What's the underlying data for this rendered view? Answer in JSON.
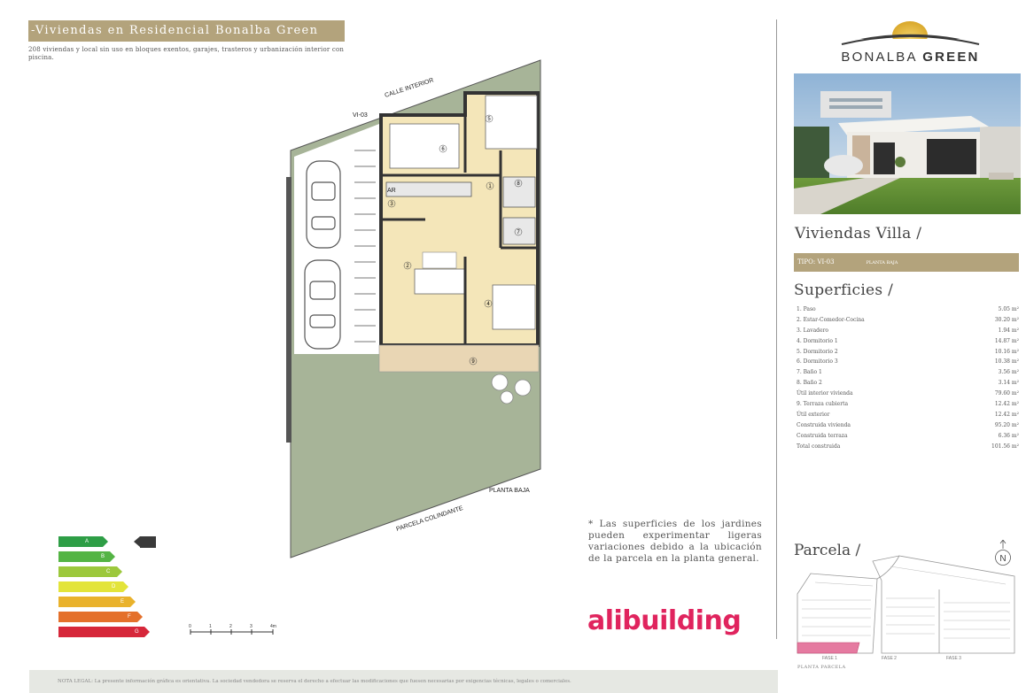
{
  "header": {
    "title": "-Viviendas en Residencial Bonalba Green",
    "subtitle": "208 viviendas y local sin uso en bloques exentos, garajes, trasteros y urbanización interior con piscina."
  },
  "plan": {
    "street_label": "CALLE INTERIOR",
    "unit_code": "VI-03",
    "floor_label": "PLANTA BAJA",
    "neighbor_label": "PARCELA COLINDANTE",
    "ar_label": "AR",
    "room_numbers": [
      "1",
      "2",
      "3",
      "4",
      "5",
      "6",
      "7",
      "8",
      "9"
    ]
  },
  "note": "* Las superficies de los jardines pueden experimentar ligeras variaciones debido a la ubicación de la parcela en la planta general.",
  "energy": {
    "classes": [
      {
        "letter": "A",
        "color": "#2e9e46"
      },
      {
        "letter": "B",
        "color": "#54b444"
      },
      {
        "letter": "C",
        "color": "#9cc83c"
      },
      {
        "letter": "D",
        "color": "#e3e43a"
      },
      {
        "letter": "E",
        "color": "#e9b22c"
      },
      {
        "letter": "F",
        "color": "#e4702b"
      },
      {
        "letter": "G",
        "color": "#d6273a"
      }
    ],
    "selected": "A"
  },
  "scale": {
    "ticks": [
      "0",
      "1",
      "2",
      "3",
      "4m"
    ]
  },
  "logo": "alibuilding",
  "legal": "NOTA LEGAL: La presente información gráfica es orientativa. La sociedad vendedora se reserva el derecho a efectuar las modificaciones que fuesen necesarias por exigencias técnicas, legales o comerciales.",
  "brand": {
    "name_light": "BONALBA",
    "name_bold": "GREEN"
  },
  "sidebar": {
    "section_villa": "Viviendas Villa /",
    "type": "TIPO: VI-03",
    "type_floor": "PLANTA BAJA",
    "section_sup": "Superficies /",
    "areas": [
      {
        "label": "1. Paso",
        "value": "5.05 m²"
      },
      {
        "label": "2. Estar-Comedor-Cocina",
        "value": "30.20 m²"
      },
      {
        "label": "3. Lavadero",
        "value": "1.94 m²"
      },
      {
        "label": "4. Dormitorio 1",
        "value": "14.87 m²"
      },
      {
        "label": "5. Dormitorio 2",
        "value": "10.16 m²"
      },
      {
        "label": "6. Dormitorio 3",
        "value": "10.38 m²"
      },
      {
        "label": "7. Baño 1",
        "value": "3.56 m²"
      },
      {
        "label": "8. Baño 2",
        "value": "3.14 m²"
      },
      {
        "label": "Útil interior vivienda",
        "value": "79.60 m²"
      },
      {
        "label": "9. Terraza cubierta",
        "value": "12.42 m²"
      },
      {
        "label": "Útil exterior",
        "value": "12.42 m²"
      },
      {
        "label": "Construida vivienda",
        "value": "95.20 m²"
      },
      {
        "label": "Construida terraza",
        "value": "6.36 m²"
      },
      {
        "label": "Total construida",
        "value": "101.56 m²"
      }
    ],
    "section_parcela": "Parcela /",
    "compass": "N",
    "phases": [
      "FASE 1",
      "FASE 2",
      "FASE 3"
    ],
    "planta_parcela": "PLANTA PARCELA"
  }
}
